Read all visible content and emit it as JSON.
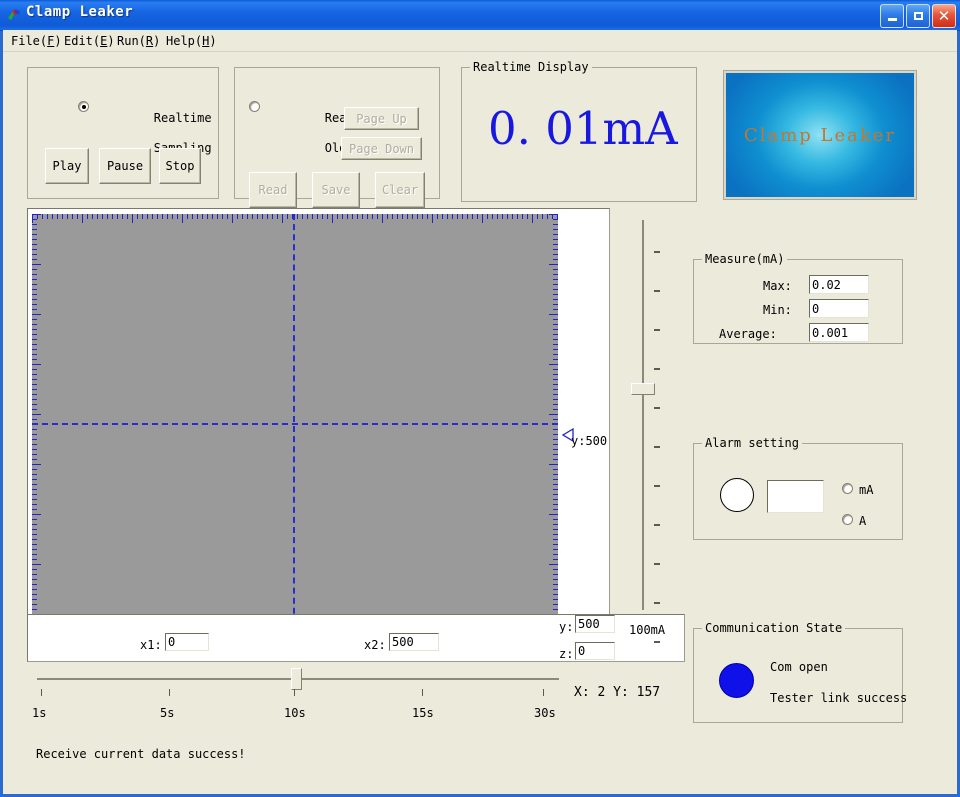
{
  "window": {
    "title": "Clamp Leaker",
    "icon": "app-icon",
    "buttons": {
      "minimize": "minimize-icon",
      "maximize": "maximize-icon",
      "close": "close-icon"
    }
  },
  "menu": [
    {
      "name": "file",
      "label": "File(F)",
      "pre": "File(",
      "key": "F",
      "post": ")"
    },
    {
      "name": "edit",
      "label": "Edit(E)",
      "pre": "Edit(",
      "key": "E",
      "post": ")"
    },
    {
      "name": "run",
      "label": "Run(R)",
      "pre": "Run(",
      "key": "R",
      "post": ")"
    },
    {
      "name": "help",
      "label": "Help(H)",
      "pre": "Help(",
      "key": "H",
      "post": ")"
    }
  ],
  "sampling_panel": {
    "radio_label_line1": "Realtime",
    "radio_label_line2": "Sampling",
    "radio_checked": true,
    "buttons": [
      {
        "label": "Play",
        "disabled": false
      },
      {
        "label": "Pause",
        "disabled": false
      },
      {
        "label": "Stop",
        "disabled": false
      }
    ]
  },
  "olddata_panel": {
    "radio_label_line1": "Read",
    "radio_label_line2": "Old Data",
    "radio_checked": false,
    "page_up": "Page Up",
    "page_down": "Page Down",
    "buttons": [
      {
        "label": "Read",
        "disabled": true
      },
      {
        "label": "Save",
        "disabled": true
      },
      {
        "label": "Clear",
        "disabled": true
      }
    ]
  },
  "realtime_display": {
    "legend": "Realtime Display",
    "value": "0. 01mA",
    "value_color": "#1818e0"
  },
  "logo": {
    "text": "Clamp Leaker",
    "text_color": "#c9752a",
    "gradient_center": "#8fe2f3",
    "gradient_edge": "#0b72c2"
  },
  "measure_panel": {
    "legend": "Measure(mA)",
    "rows": [
      {
        "label": "Max:",
        "value": "0.02"
      },
      {
        "label": "Min:",
        "value": "0"
      },
      {
        "label": "Average:",
        "value": "0.001"
      }
    ]
  },
  "alarm_panel": {
    "legend": "Alarm setting",
    "led_color": "#ffffff",
    "threshold_value": "",
    "units": [
      {
        "label": "mA",
        "checked": false
      },
      {
        "label": "A",
        "checked": false
      }
    ]
  },
  "comm_panel": {
    "legend": "Communication State",
    "led_color": "#1010e8",
    "line1": "Com open",
    "line2": "Tester link success"
  },
  "plot": {
    "bg_color": "#9a9a9a",
    "ruler_color": "#2222cc",
    "grid_color": "#2c2ccc",
    "marker_x1": "1:0",
    "marker_x2": "x2:500",
    "marker_y": "y:500",
    "marker_z": "z:0"
  },
  "cursor_fields": {
    "x1_label": "x1:",
    "x1_value": "0",
    "x2_label": "x2:",
    "x2_value": "500",
    "y_label": "y:",
    "y_value": "500",
    "z_label": "z:",
    "z_value": "0"
  },
  "range_slider": {
    "unit_label": "100mA"
  },
  "time_slider": {
    "ticks": [
      "1s",
      "5s",
      "10s",
      "15s",
      "30s"
    ],
    "selected": "10s"
  },
  "coords": {
    "text": "X: 2 Y: 157"
  },
  "status": {
    "message": "Receive current data success!"
  }
}
